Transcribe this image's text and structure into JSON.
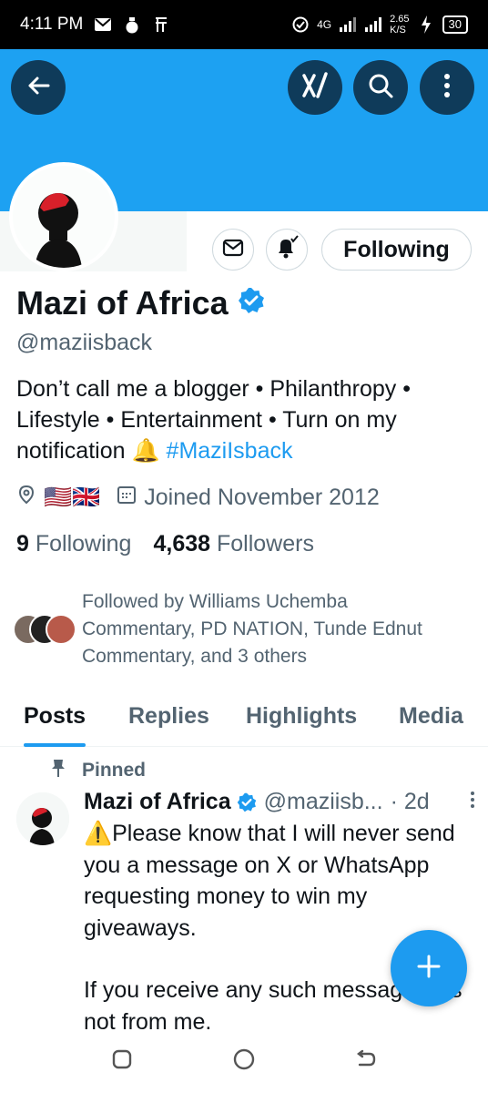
{
  "status_bar": {
    "time": "4:11 PM",
    "network": "4G",
    "speed_value": "2.65",
    "speed_unit": "K/S",
    "battery": "30"
  },
  "header": {
    "back_icon": "arrow-left-icon",
    "grok_icon": "grok-icon",
    "search_icon": "search-icon",
    "more_icon": "more-vertical-icon",
    "banner_color": "#1da1f2"
  },
  "profile": {
    "name": "Mazi of Africa",
    "handle": "@maziisback",
    "bio_text": "Don’t call me a blogger • Philanthropy • Lifestyle • Entertainment • Turn on my notification 🔔 ",
    "bio_hashtag": "#MaziIsback",
    "location_flags": "🇺🇸🇬🇧",
    "joined": "Joined November 2012",
    "following_count": "9",
    "following_label": "Following",
    "followers_count": "4,638",
    "followers_label": "Followers",
    "followed_by": "Followed by Williams Uchemba Commentary, PD NATION, Tunde Ednut Commentary, and 3 others",
    "following_button": "Following"
  },
  "tabs": [
    {
      "label": "Posts",
      "active": true
    },
    {
      "label": "Replies",
      "active": false
    },
    {
      "label": "Highlights",
      "active": false
    },
    {
      "label": "Media",
      "active": false
    }
  ],
  "post": {
    "pinned_label": "Pinned",
    "author": "Mazi of Africa",
    "handle": "@maziisb...",
    "time": "· 2d",
    "body_line1": "⚠️Please know that I will never send you a message on X or WhatsApp requesting money to win my giveaways.",
    "body_line2": "If you receive any such message, it is not from me."
  },
  "colors": {
    "accent": "#1d9bf0",
    "verified": "#1d9bf0",
    "text_secondary": "#536471"
  }
}
